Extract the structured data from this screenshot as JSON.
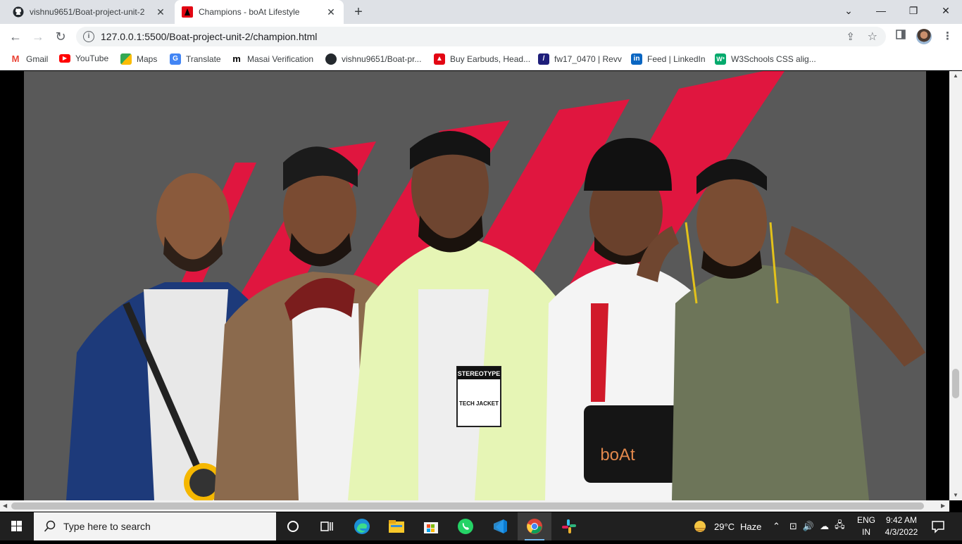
{
  "tabs": [
    {
      "title": "vishnu9651/Boat-project-unit-2",
      "icon": "github-icon",
      "active": false
    },
    {
      "title": "Champions - boAt Lifestyle",
      "icon": "boat-icon",
      "active": true
    }
  ],
  "window_controls": {
    "minimize": "—",
    "maximize": "❐",
    "close": "✕",
    "dropdown": "⌄"
  },
  "toolbar": {
    "url": "127.0.0.1:5500/Boat-project-unit-2/champion.html",
    "back": "←",
    "forward": "→",
    "reload": "↻"
  },
  "bookmarks": [
    {
      "label": "Gmail",
      "icon": "gmail-icon",
      "color": "#ea4335"
    },
    {
      "label": "YouTube",
      "icon": "youtube-icon",
      "color": "#ff0000"
    },
    {
      "label": "Maps",
      "icon": "maps-icon",
      "color": "#34a853"
    },
    {
      "label": "Translate",
      "icon": "translate-icon",
      "color": "#4285f4"
    },
    {
      "label": "Masai Verification",
      "icon": "masai-icon",
      "color": "#000000"
    },
    {
      "label": "vishnu9651/Boat-pr...",
      "icon": "github-icon",
      "color": "#24292e"
    },
    {
      "label": "Buy Earbuds, Head...",
      "icon": "boat-icon",
      "color": "#e30613"
    },
    {
      "label": "fw17_0470 | Revv",
      "icon": "revv-icon",
      "color": "#1e1e7a"
    },
    {
      "label": "Feed | LinkedIn",
      "icon": "linkedin-icon",
      "color": "#0a66c2"
    },
    {
      "label": "W3Schools CSS alig...",
      "icon": "w3schools-icon",
      "color": "#04aa6d"
    }
  ],
  "hero": {
    "description": "",
    "colors": {
      "background": "#595959",
      "stripe": "#e0163f"
    },
    "products": {
      "headphone": "boAt",
      "speaker": "boAt"
    },
    "jacket_text": [
      "STEREOTYPE",
      "TECH JACKET"
    ]
  },
  "taskbar": {
    "search_placeholder": "Type here to search",
    "weather": {
      "temp": "29°C",
      "condition": "Haze"
    },
    "language": {
      "lang": "ENG",
      "region": "IN"
    },
    "time": "9:42 AM",
    "date": "4/3/2022",
    "apps": [
      "task-view-icon",
      "edge-icon",
      "file-explorer-icon",
      "store-icon",
      "whatsapp-icon",
      "vscode-icon",
      "chrome-icon",
      "slack-icon"
    ]
  }
}
